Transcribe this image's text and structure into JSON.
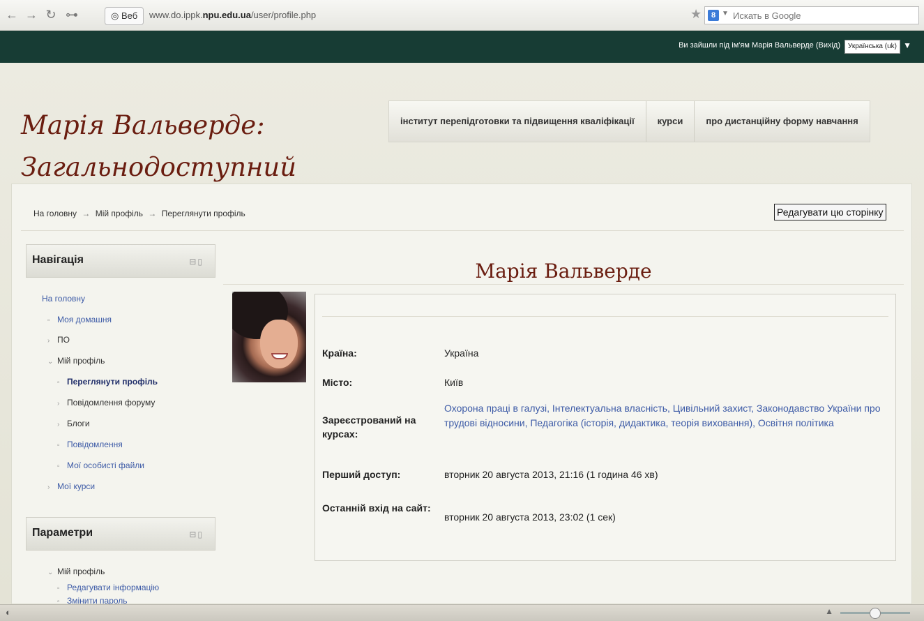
{
  "browser": {
    "back": "←",
    "forward": "→",
    "reload": "↻",
    "key": "⊶",
    "web_label": "Веб",
    "url_prefix": "www.do.ippk.",
    "url_domain": "npu.edu.ua",
    "url_path": "/user/profile.php",
    "search_placeholder": "Искать в Google",
    "search_badge": "8"
  },
  "topbar": {
    "login_text": "Ви зайшли під ім'ям Марія Вальверде (",
    "logout": "Вихід",
    "login_close": ")",
    "language": "Українська (uk)"
  },
  "site_title": "Марія Вальверде: Загальнодоступний",
  "menu": [
    "інститут перепідготовки та підвищення кваліфікації",
    "курси",
    "про дистанційну форму навчання"
  ],
  "breadcrumb": {
    "home": "На головну",
    "my_profile": "Мій профіль",
    "view_profile": "Переглянути профіль",
    "sep": "→"
  },
  "edit_button": "Редагувати цю сторінку",
  "navigation": {
    "title": "Навігація",
    "home": "На головну",
    "my_home": "Моя домашня",
    "po": "ПО",
    "my_profile": "Мій профіль",
    "view_profile": "Переглянути профіль",
    "forum_posts": "Повідомлення форуму",
    "blogs": "Блоги",
    "messages": "Повідомлення",
    "private_files": "Мої особисті файли",
    "my_courses": "Мої курси"
  },
  "settings": {
    "title": "Параметри",
    "my_profile": "Мій профіль",
    "edit_info": "Редагувати інформацію",
    "change_password": "Змінити пароль"
  },
  "profile": {
    "name": "Марія Вальверде",
    "country_label": "Країна:",
    "country": "Україна",
    "city_label": "Місто:",
    "city": "Київ",
    "courses_label": "Зареєстрований на курсах:",
    "courses": "Охорона праці в галузі, Інтелектуальна власність, Цивільний захист, Законодавство України про трудові відносини, Педагогіка (історія, дидактика, теорія виховання), Освітня політика",
    "first_access_label": "Перший доступ:",
    "first_access": "вторник 20 августа 2013, 21:16  (1 година 46 хв)",
    "last_access_label": "Останній вхід на сайт:",
    "last_access": "вторник 20 августа 2013, 23:02  (1 сек)"
  }
}
